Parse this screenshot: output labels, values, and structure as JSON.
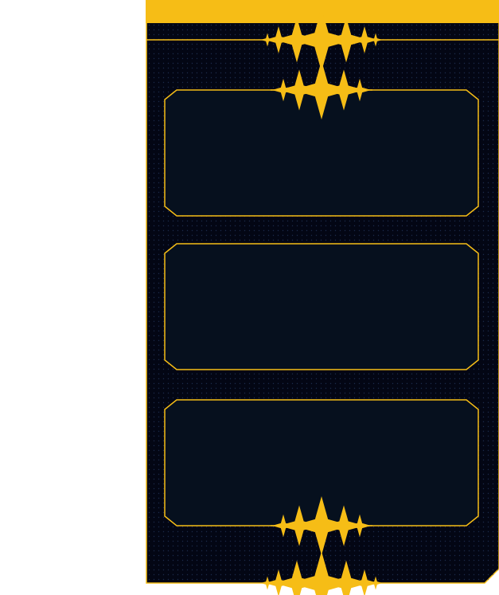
{
  "theme": {
    "background": "#ffffff",
    "panel_fill": "#030614",
    "card_fill": "#06101e",
    "accent": "#f6bd16",
    "dot_color": "#1c2a4a"
  },
  "panel": {
    "header_bar": {
      "label": ""
    },
    "cards": [
      {
        "name": "card-1",
        "label": ""
      },
      {
        "name": "card-2",
        "label": ""
      },
      {
        "name": "card-3",
        "label": ""
      }
    ]
  },
  "icons": [
    "sparkle-ornament-icon"
  ]
}
